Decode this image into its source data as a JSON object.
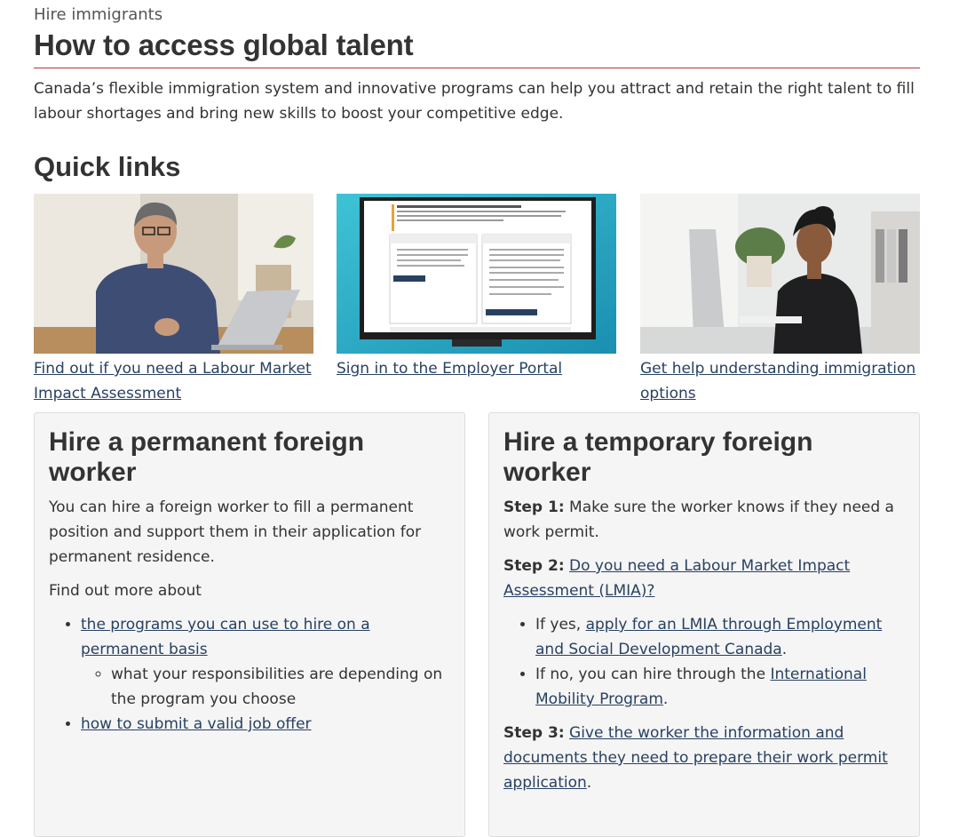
{
  "breadcrumb_kicker": "Hire immigrants",
  "page_title": "How to access global talent",
  "intro": "Canada’s flexible immigration system and innovative programs can help you attract and retain the right talent to fill labour shortages and bring new skills to boost your competitive edge.",
  "quick_links": {
    "title": "Quick links",
    "items": [
      {
        "label": "Find out if you need a Labour Market Impact Assessment",
        "image": "man-with-laptop-photo"
      },
      {
        "label": "Sign in to the Employer Portal",
        "image": "employer-portal-screen-image"
      },
      {
        "label": "Get help understanding immigration options",
        "image": "woman-at-computer-photo"
      }
    ]
  },
  "permanent": {
    "title": "Hire a permanent foreign worker",
    "intro": "You can hire a foreign worker to fill a permanent position and support them in their application for permanent residence.",
    "find_more": "Find out more about",
    "link1": "the programs you can use to hire on a permanent basis",
    "sub1": "what your responsibilities are depending on the program you choose",
    "link2": "how to submit a valid job offer"
  },
  "temporary": {
    "title": "Hire a temporary foreign worker",
    "step1_label": "Step 1:",
    "step1_text": " Make sure the worker knows if they need a work permit.",
    "step2_label": "Step 2:",
    "step2_link": "Do you need a Labour Market Impact Assessment (LMIA)?",
    "yes_prefix": "If yes, ",
    "yes_link": "apply for an LMIA through Employment and Social Development Canada",
    "yes_suffix": ".",
    "no_prefix": "If no, you can hire through the ",
    "no_link": "International Mobility Program",
    "no_suffix": ".",
    "step3_label": "Step 3:",
    "step3_link": "Give the worker the information and documents they need to prepare their work permit application",
    "step3_suffix": "."
  },
  "colors": {
    "link": "#284162",
    "title_rule": "#af3c43",
    "panel_bg": "#f5f5f5"
  }
}
